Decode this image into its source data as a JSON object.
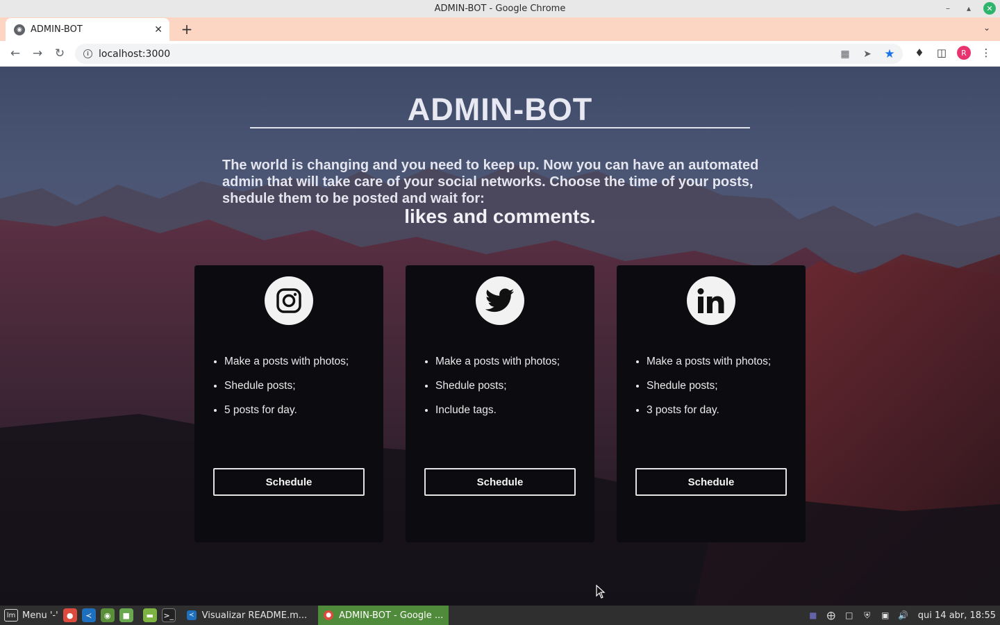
{
  "window": {
    "title": "ADMIN-BOT - Google Chrome"
  },
  "browser": {
    "tab_title": "ADMIN-BOT",
    "url": "localhost:3000",
    "profile_initial": "R"
  },
  "page": {
    "title": "ADMIN-BOT",
    "intro": "The world is changing and you need to keep up. Now you can have an automated admin that will take care of your social networks. Choose the time of your posts, shedule them to be posted and wait for:",
    "emphasis": "likes and comments.",
    "cards": [
      {
        "icon": "instagram-icon",
        "features": [
          "Make a posts with photos;",
          "Shedule posts;",
          "5 posts for day."
        ],
        "button": "Schedule"
      },
      {
        "icon": "twitter-icon",
        "features": [
          "Make a posts with photos;",
          "Shedule posts;",
          "Include tags."
        ],
        "button": "Schedule"
      },
      {
        "icon": "linkedin-icon",
        "features": [
          "Make a posts with photos;",
          "Shedule posts;",
          "3 posts for day."
        ],
        "button": "Schedule"
      }
    ]
  },
  "taskbar": {
    "menu_label": "Menu '-'",
    "tasks": [
      "Visualizar README.m...",
      "ADMIN-BOT - Google ..."
    ],
    "clock": "qui 14 abr, 18:55"
  },
  "colors": {
    "card_bg": "#0c0c10",
    "tab_strip": "#fdd5c3",
    "active_task": "#4f8b3a"
  }
}
